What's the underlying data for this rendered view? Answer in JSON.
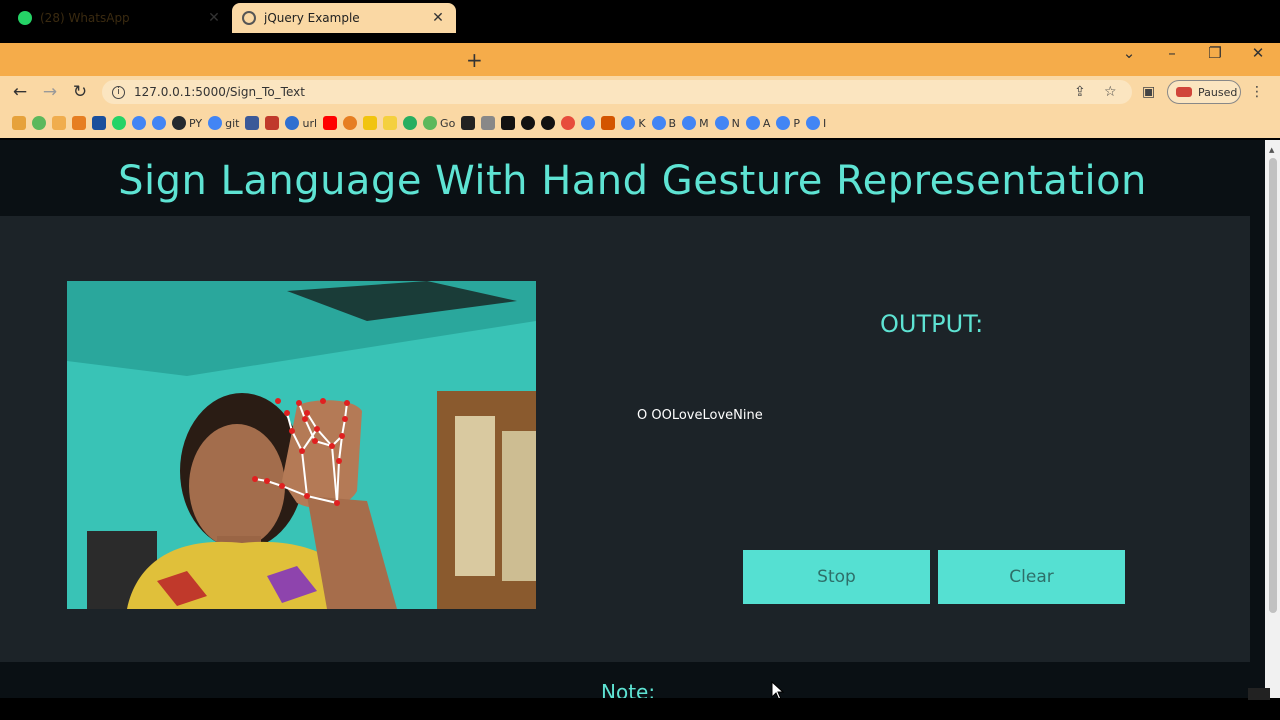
{
  "browser": {
    "tabs": [
      {
        "title": "(28) WhatsApp",
        "favicon": "whatsapp-icon",
        "active": false
      },
      {
        "title": "jQuery Example",
        "favicon": "globe-icon",
        "active": true
      }
    ],
    "address": "127.0.0.1:5000/Sign_To_Text",
    "profile_status": "Paused",
    "bookmarks": [
      "",
      "",
      "",
      "",
      "",
      "",
      "",
      "",
      "PY",
      "git",
      "",
      "",
      "url",
      "",
      "",
      "",
      "",
      "",
      "Go",
      "",
      "",
      "",
      "",
      "",
      "",
      "",
      "",
      "K",
      "B",
      "M",
      "N",
      "A",
      "P",
      "I"
    ],
    "accent_color": "#f5ac4a"
  },
  "page": {
    "title": "Sign Language With Hand Gesture Representation",
    "output_label": "OUTPUT:",
    "output_text": "O OOLoveLoveNine",
    "stop_label": "Stop",
    "clear_label": "Clear",
    "note_label": "Note:",
    "accent_color": "#5ee3d3",
    "button_color": "#55e0d2"
  }
}
